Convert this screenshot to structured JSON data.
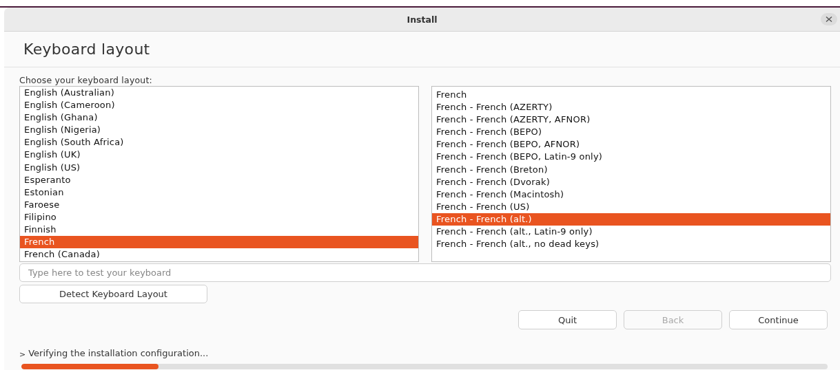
{
  "window": {
    "title": "Install"
  },
  "page_title": "Keyboard layout",
  "prompt": "Choose your keyboard layout:",
  "layouts": [
    {
      "label": "English (Australian)",
      "selected": false
    },
    {
      "label": "English (Cameroon)",
      "selected": false
    },
    {
      "label": "English (Ghana)",
      "selected": false
    },
    {
      "label": "English (Nigeria)",
      "selected": false
    },
    {
      "label": "English (South Africa)",
      "selected": false
    },
    {
      "label": "English (UK)",
      "selected": false
    },
    {
      "label": "English (US)",
      "selected": false
    },
    {
      "label": "Esperanto",
      "selected": false
    },
    {
      "label": "Estonian",
      "selected": false
    },
    {
      "label": "Faroese",
      "selected": false
    },
    {
      "label": "Filipino",
      "selected": false
    },
    {
      "label": "Finnish",
      "selected": false
    },
    {
      "label": "French",
      "selected": true
    },
    {
      "label": "French (Canada)",
      "selected": false
    }
  ],
  "variants": [
    {
      "label": "French",
      "selected": false
    },
    {
      "label": "French - French (AZERTY)",
      "selected": false
    },
    {
      "label": "French - French (AZERTY, AFNOR)",
      "selected": false
    },
    {
      "label": "French - French (BEPO)",
      "selected": false
    },
    {
      "label": "French - French (BEPO, AFNOR)",
      "selected": false
    },
    {
      "label": "French - French (BEPO, Latin-9 only)",
      "selected": false
    },
    {
      "label": "French - French (Breton)",
      "selected": false
    },
    {
      "label": "French - French (Dvorak)",
      "selected": false
    },
    {
      "label": "French - French (Macintosh)",
      "selected": false
    },
    {
      "label": "French - French (US)",
      "selected": false
    },
    {
      "label": "French - French (alt.)",
      "selected": true
    },
    {
      "label": "French - French (alt., Latin-9 only)",
      "selected": false
    },
    {
      "label": "French - French (alt., no dead keys)",
      "selected": false
    }
  ],
  "test_field": {
    "placeholder": "Type here to test your keyboard"
  },
  "detect_button": "Detect Keyboard Layout",
  "buttons": [
    {
      "label": "Quit",
      "disabled": false
    },
    {
      "label": "Back",
      "disabled": true
    },
    {
      "label": "Continue",
      "disabled": false
    }
  ],
  "status": {
    "text": "Verifying the installation configuration...",
    "expander": ">",
    "level": 0.17
  }
}
